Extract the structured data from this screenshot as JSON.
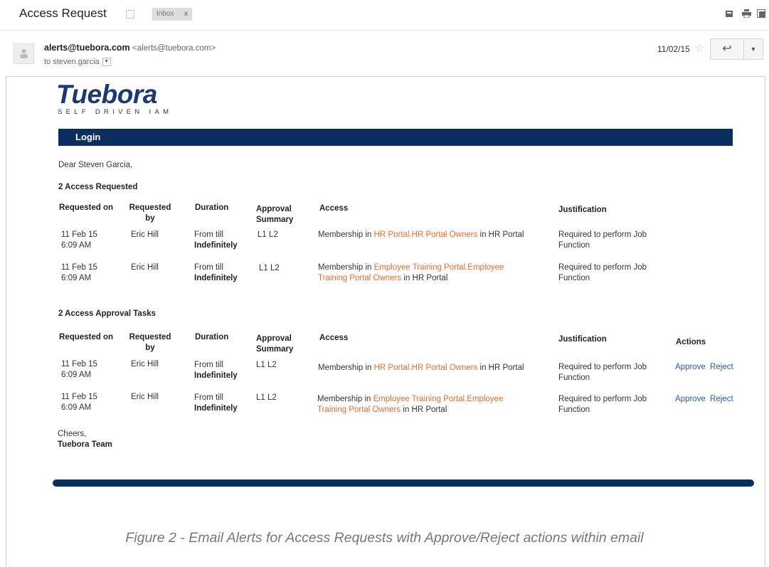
{
  "header": {
    "subject": "Access Request",
    "label_chip": "Inbox",
    "label_chip_close": "x"
  },
  "sender": {
    "name": "alerts@tuebora.com",
    "address": "<alerts@tuebora.com>",
    "to": "to steven.garcia",
    "date": "11/02/15"
  },
  "email": {
    "logo": "Tuebora",
    "logo_tagline": "SELF DRIVEN IAM",
    "login": "Login",
    "greeting": "Dear Steven Garcia,",
    "section1_title": "2 Access Requested",
    "section2_title": "2 Access Approval Tasks",
    "columns": {
      "requested_on": "Requested on",
      "requested_by_1": "Requested",
      "requested_by_2": "by",
      "duration": "Duration",
      "approval_1": "Approval",
      "approval_2": "Summary",
      "access": "Access",
      "justification": "Justification",
      "actions": "Actions"
    },
    "rows": [
      {
        "date": "11 Feb 15",
        "time": "6:09 AM",
        "by": "Eric Hill",
        "duration_1": "From till",
        "duration_2": "Indefinitely",
        "approval": "L1 L2",
        "access_prefix": "Membership in ",
        "access_link_1": "HR Portal.HR Portal Owners",
        "access_link_2": "",
        "access_suffix": " in HR Portal",
        "justification_1": "Required to perform Job",
        "justification_2": "Function"
      },
      {
        "date": "11 Feb 15",
        "time": "6:09 AM",
        "by": "Eric Hill",
        "duration_1": "From till",
        "duration_2": "Indefinitely",
        "approval": "L1 L2",
        "access_prefix": "Membership in ",
        "access_link_1": "Employee Training Portal.Employee",
        "access_link_2": "Training Portal Owners",
        "access_suffix": " in HR Portal",
        "justification_1": "Required to perform Job",
        "justification_2": "Function"
      }
    ],
    "approve": "Approve",
    "reject": "Reject",
    "signoff": "Cheers,",
    "team": "Tuebora Team"
  },
  "caption": "Figure 2 - Email Alerts for Access Requests with Approve/Reject actions within email"
}
